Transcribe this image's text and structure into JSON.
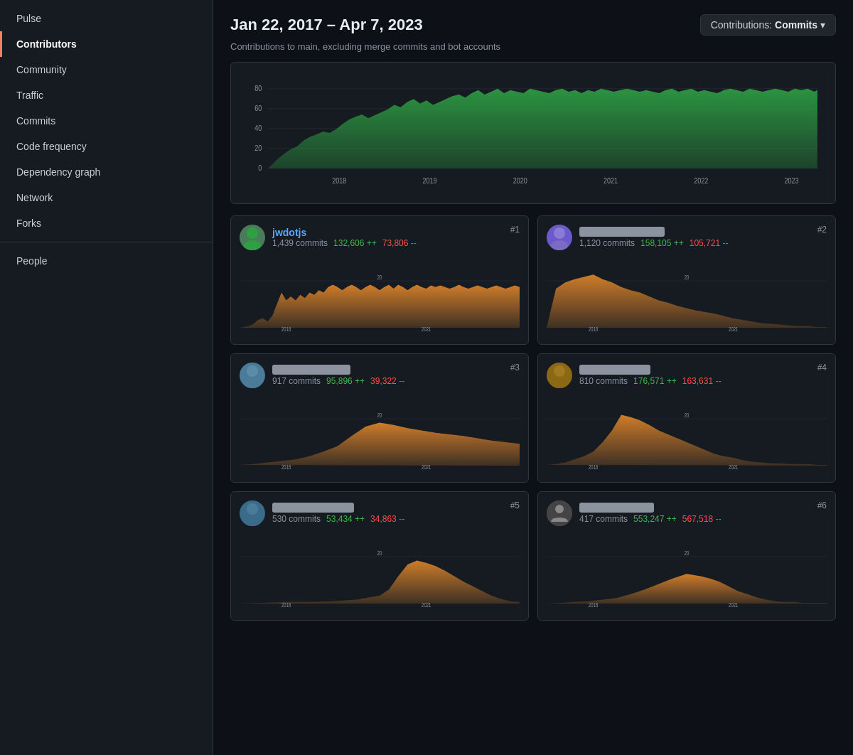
{
  "sidebar": {
    "sections": [
      {
        "items": [
          {
            "id": "pulse",
            "label": "Pulse",
            "active": false
          },
          {
            "id": "contributors",
            "label": "Contributors",
            "active": true
          },
          {
            "id": "community",
            "label": "Community",
            "active": false
          },
          {
            "id": "traffic",
            "label": "Traffic",
            "active": false
          },
          {
            "id": "commits",
            "label": "Commits",
            "active": false
          },
          {
            "id": "code-frequency",
            "label": "Code frequency",
            "active": false
          },
          {
            "id": "dependency-graph",
            "label": "Dependency graph",
            "active": false
          },
          {
            "id": "network",
            "label": "Network",
            "active": false
          },
          {
            "id": "forks",
            "label": "Forks",
            "active": false
          }
        ]
      },
      {
        "items": [
          {
            "id": "people",
            "label": "People",
            "active": false
          }
        ]
      }
    ]
  },
  "header": {
    "date_range": "Jan 22, 2017 – Apr 7, 2023",
    "contributions_button": "Contributions: Commits ▾",
    "contributions_label": "Contributions: ",
    "contributions_type": "Commits",
    "subtitle": "Contributions to main, excluding merge commits and bot accounts"
  },
  "main_chart": {
    "y_labels": [
      "80",
      "60",
      "40",
      "20",
      "0"
    ],
    "x_labels": [
      "2018",
      "2019",
      "2020",
      "2021",
      "2022",
      "2023"
    ]
  },
  "contributors": [
    {
      "rank": "#1",
      "name": "jwdotjs",
      "commits": "1,439 commits",
      "additions": "132,606 ++",
      "deletions": "73,806 --",
      "x_labels": [
        "2018",
        "2021"
      ],
      "y_label": "20",
      "blurred": false,
      "avatar_color": "#4a7c59"
    },
    {
      "rank": "#2",
      "name": "████████████",
      "commits": "1,120 commits",
      "additions": "158,105 ++",
      "deletions": "105,721 --",
      "x_labels": [
        "2018",
        "2021"
      ],
      "y_label": "20",
      "blurred": true,
      "avatar_color": "#6a5acd"
    },
    {
      "rank": "#3",
      "name": "████████████",
      "commits": "917 commits",
      "additions": "95,896 ++",
      "deletions": "39,322 --",
      "x_labels": [
        "2018",
        "2021"
      ],
      "y_label": "20",
      "blurred": true,
      "avatar_color": "#4a7c99"
    },
    {
      "rank": "#4",
      "name": "████████████",
      "commits": "810 commits",
      "additions": "176,571 ++",
      "deletions": "163,631 --",
      "x_labels": [
        "2018",
        "2021"
      ],
      "y_label": "20",
      "blurred": true,
      "avatar_color": "#8b6914"
    },
    {
      "rank": "#5",
      "name": "████████████",
      "commits": "530 commits",
      "additions": "53,434 ++",
      "deletions": "34,863 --",
      "x_labels": [
        "2018",
        "2021"
      ],
      "y_label": "20",
      "blurred": true,
      "avatar_color": "#3a6b8a"
    },
    {
      "rank": "#6",
      "name": "████████████",
      "commits": "417 commits",
      "additions": "553,247 ++",
      "deletions": "567,518 --",
      "x_labels": [
        "2018",
        "2021"
      ],
      "y_label": "20",
      "blurred": true,
      "avatar_color": "#555"
    }
  ]
}
